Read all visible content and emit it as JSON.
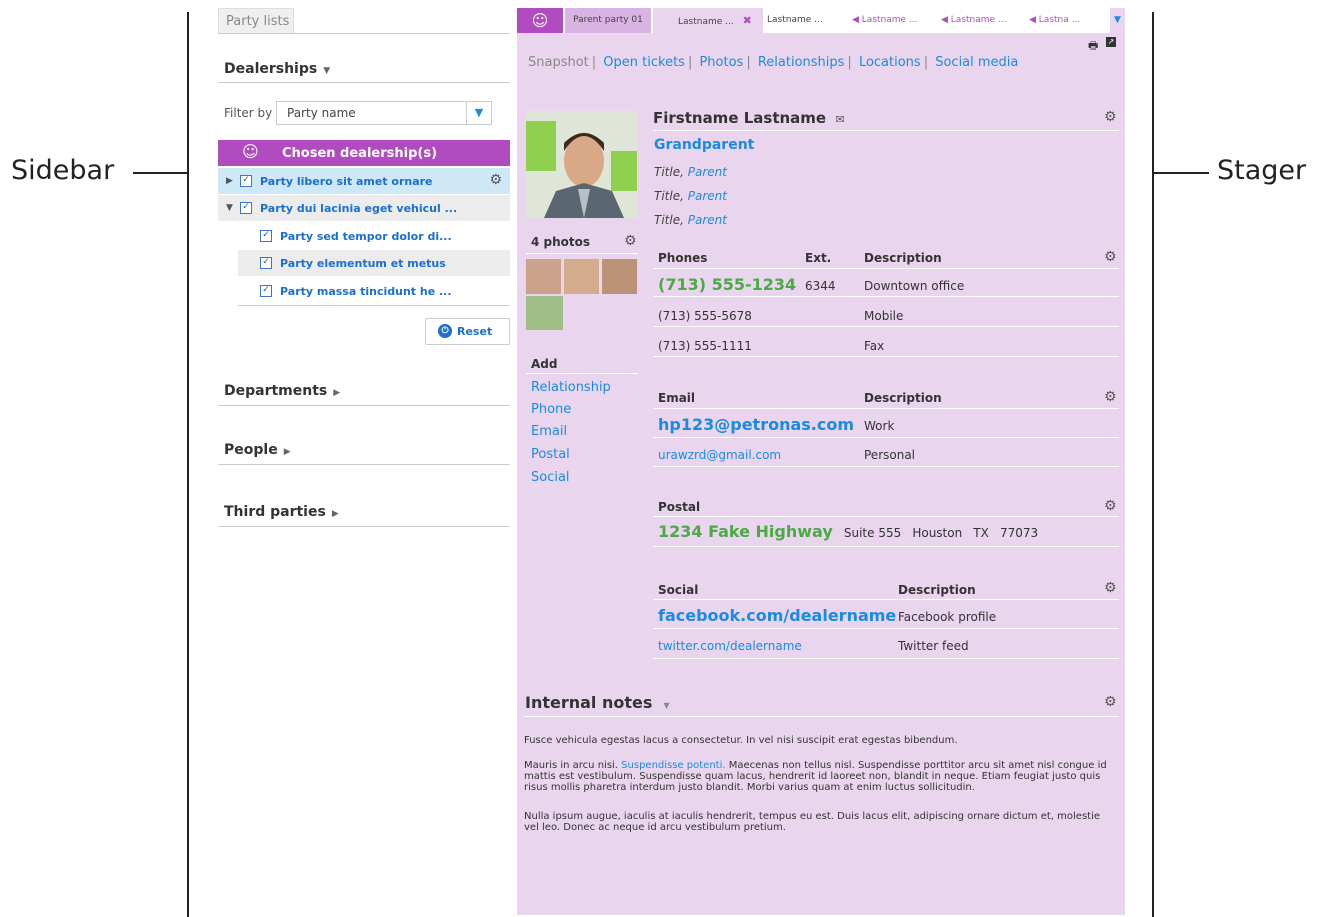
{
  "annotations": {
    "left": "Sidebar",
    "right": "Stager"
  },
  "sidebar": {
    "tab_label": "Party lists",
    "dealerships_label": "Dealerships",
    "filter_label": "Filter by",
    "filter_value": "Party name",
    "chosen_label": "Chosen dealership(s)",
    "parties": [
      {
        "label": "Party libero sit amet ornare"
      },
      {
        "label": "Party dui lacinia eget vehicul ..."
      },
      {
        "label": "Party sed tempor dolor di..."
      },
      {
        "label": "Party elementum et metus"
      },
      {
        "label": "Party massa tincidunt he ..."
      }
    ],
    "reset_label": "Reset",
    "sections": [
      "Departments",
      "People",
      "Third parties"
    ]
  },
  "stager": {
    "tabs": [
      "Parent party 01",
      "Lastname ...",
      "Lastname ...",
      "Lastname ...",
      "Lastname ...",
      "Lastna ..."
    ],
    "nav": [
      "Snapshot",
      "Open tickets",
      "Photos",
      "Relationships",
      "Locations",
      "Social media"
    ],
    "name": "Firstname Lastname",
    "relation": "Grandparent",
    "titles": [
      {
        "title": "Title,",
        "parent": "Parent"
      },
      {
        "title": "Title,",
        "parent": "Parent"
      },
      {
        "title": "Title,",
        "parent": "Parent"
      }
    ],
    "photos_label": "4 photos",
    "add_label": "Add",
    "add_links": [
      "Relationship",
      "Phone",
      "Email",
      "Postal",
      "Social"
    ],
    "phones": {
      "headers": [
        "Phones",
        "Ext.",
        "Description"
      ],
      "rows": [
        {
          "number": "(713) 555-1234",
          "ext": "6344",
          "desc": "Downtown office"
        },
        {
          "number": "(713) 555-5678",
          "ext": "",
          "desc": "Mobile"
        },
        {
          "number": "(713) 555-1111",
          "ext": "",
          "desc": "Fax"
        }
      ]
    },
    "email": {
      "headers": [
        "Email",
        "Description"
      ],
      "rows": [
        {
          "address": "hp123@petronas.com",
          "desc": "Work"
        },
        {
          "address": "urawzrd@gmail.com",
          "desc": "Personal"
        }
      ]
    },
    "postal": {
      "header": "Postal",
      "street": "1234 Fake Highway",
      "suite": "Suite 555",
      "city": "Houston",
      "state": "TX",
      "zip": "77073"
    },
    "social": {
      "headers": [
        "Social",
        "Description"
      ],
      "rows": [
        {
          "url": "facebook.com/dealername",
          "desc": "Facebook profile"
        },
        {
          "url": "twitter.com/dealername",
          "desc": "Twitter feed"
        }
      ]
    },
    "notes": {
      "header": "Internal notes",
      "p1": "Fusce vehicula egestas lacus a consectetur. In vel nisi suscipit erat egestas bibendum.",
      "p2_pre": "Mauris in arcu nisi.",
      "p2_link": "Suspendisse potenti.",
      "p2_post": "Maecenas non tellus nisl. Suspendisse porttitor arcu sit amet nisl congue id mattis est vestibulum. Suspendisse quam lacus, hendrerit id laoreet non, blandit in neque. Etiam feugiat justo quis risus mollis pharetra interdum justo blandit. Morbi varius quam at enim luctus sollicitudin.",
      "p3": "Nulla ipsum augue, iaculis at iaculis hendrerit, tempus eu est. Duis lacus elit, adipiscing ornare dictum et, molestie vel leo. Donec ac neque id arcu vestibulum pretium."
    }
  }
}
